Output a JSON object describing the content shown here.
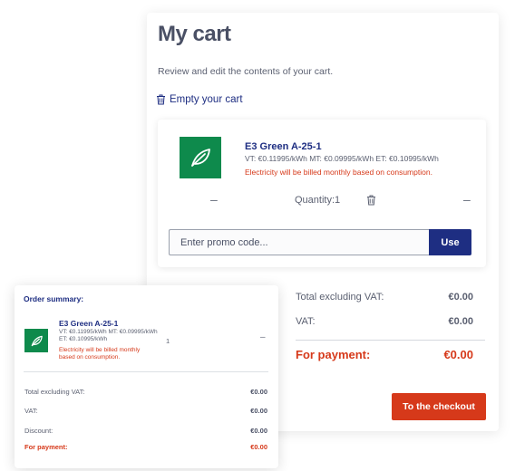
{
  "cart": {
    "title": "My cart",
    "subtitle": "Review and edit the contents of your cart.",
    "empty_label": "Empty your cart",
    "product": {
      "name": "E3 Green A-25-1",
      "prices": "VT: €0.11995/kWh MT: €0.09995/kWh ET: €0.10995/kWh",
      "note": "Electricity will be billed monthly based on consumption.",
      "quantity_label": "Quantity:1",
      "minus_symbol": "–"
    },
    "promo": {
      "placeholder": "Enter promo code...",
      "button": "Use"
    },
    "totals": {
      "excl_vat_label": "Total excluding VAT:",
      "excl_vat_value": "€0.00",
      "vat_label": "VAT:",
      "vat_value": "€0.00",
      "payment_label": "For payment:",
      "payment_value": "€0.00"
    },
    "checkout_label": "To the checkout"
  },
  "summary": {
    "title": "Order summary:",
    "product": {
      "name": "E3 Green A-25-1",
      "prices": "VT: €0.11995/kWh MT: €0.09995/kWh ET: €0.10995/kWh",
      "note": "Electricity will be billed monthly based on consumption.",
      "quantity": "1",
      "minus_symbol": "–"
    },
    "rows": {
      "excl_vat_label": "Total excluding VAT:",
      "excl_vat_value": "€0.00",
      "vat_label": "VAT:",
      "vat_value": "€0.00",
      "discount_label": "Discount:",
      "discount_value": "€0.00",
      "payment_label": "For payment:",
      "payment_value": "€0.00"
    }
  },
  "colors": {
    "brand_blue": "#1e2e82",
    "accent_orange": "#d6391a",
    "leaf_green": "#0e8a4c"
  },
  "icons": [
    "trash-icon",
    "leaf-icon",
    "minus-icon"
  ]
}
